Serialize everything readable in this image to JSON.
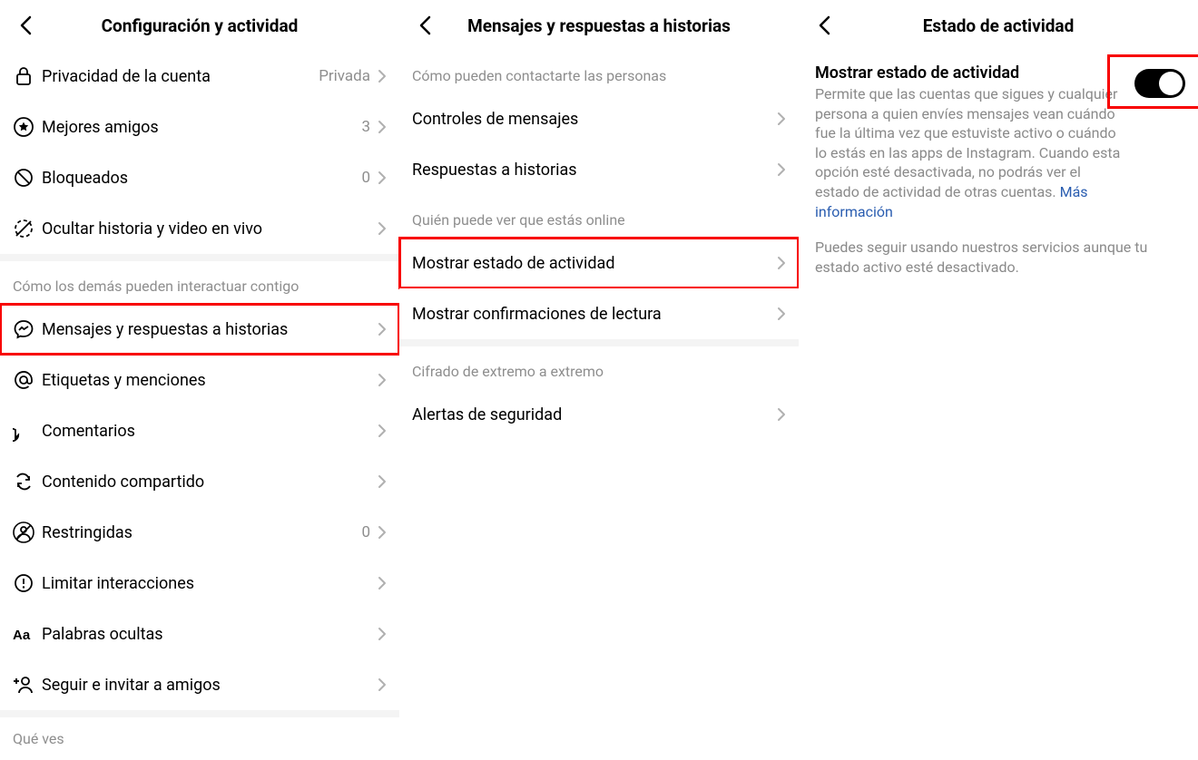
{
  "pane1": {
    "title": "Configuración y actividad",
    "rows_a": [
      {
        "key": "privacy",
        "label": "Privacidad de la cuenta",
        "meta": "Privada"
      },
      {
        "key": "best",
        "label": "Mejores amigos",
        "meta": "3"
      },
      {
        "key": "blocked",
        "label": "Bloqueados",
        "meta": "0"
      },
      {
        "key": "hide",
        "label": "Ocultar historia y video en vivo",
        "meta": ""
      }
    ],
    "section_b": "Cómo los demás pueden interactuar contigo",
    "rows_b": [
      {
        "key": "messages",
        "label": "Mensajes y respuestas a historias",
        "meta": "",
        "hl": true
      },
      {
        "key": "tags",
        "label": "Etiquetas y menciones",
        "meta": ""
      },
      {
        "key": "comments",
        "label": "Comentarios",
        "meta": ""
      },
      {
        "key": "shared",
        "label": "Contenido compartido",
        "meta": ""
      },
      {
        "key": "restricted",
        "label": "Restringidas",
        "meta": "0"
      },
      {
        "key": "limit",
        "label": "Limitar interacciones",
        "meta": ""
      },
      {
        "key": "hiddenw",
        "label": "Palabras ocultas",
        "meta": ""
      },
      {
        "key": "invite",
        "label": "Seguir e invitar a amigos",
        "meta": ""
      }
    ],
    "section_c": "Qué ves"
  },
  "pane2": {
    "title": "Mensajes y respuestas a historias",
    "section_a": "Cómo pueden contactarte las personas",
    "rows_a": [
      {
        "key": "controls",
        "label": "Controles de mensajes"
      },
      {
        "key": "replies",
        "label": "Respuestas a historias"
      }
    ],
    "section_b": "Quién puede ver que estás online",
    "rows_b": [
      {
        "key": "status",
        "label": "Mostrar estado de actividad",
        "hl": true
      },
      {
        "key": "readrec",
        "label": "Mostrar confirmaciones de lectura"
      }
    ],
    "section_c": "Cifrado de extremo a extremo",
    "rows_c": [
      {
        "key": "alerts",
        "label": "Alertas de seguridad"
      }
    ]
  },
  "pane3": {
    "title": "Estado de actividad",
    "heading": "Mostrar estado de actividad",
    "description": "Permite que las cuentas que sigues y cualquier persona a quien envíes mensajes vean cuándo fue la última vez que estuviste activo o cuándo lo estás en las apps de Instagram. Cuando esta opción esté desactivada, no podrás ver el estado de actividad de otras cuentas. ",
    "more_info": "Más información",
    "note": "Puedes seguir usando nuestros servicios aunque tu estado activo esté desactivado.",
    "toggle_on": true
  }
}
